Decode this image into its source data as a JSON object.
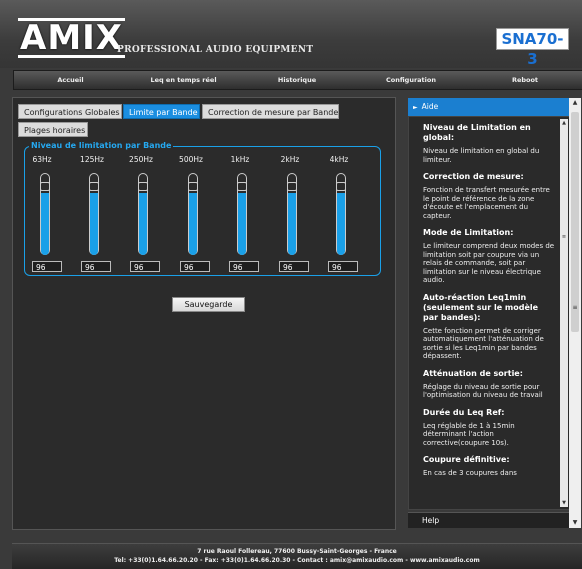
{
  "header": {
    "logo": "AMIX",
    "tagline": "PROFESSIONAL AUDIO EQUIPMENT",
    "model": "SNA70-3"
  },
  "nav": [
    {
      "label": "Accueil"
    },
    {
      "label": "Leq en temps réel"
    },
    {
      "label": "Historique"
    },
    {
      "label": "Configuration"
    },
    {
      "label": "Reboot"
    }
  ],
  "tabs": [
    {
      "label": "Configurations Globales",
      "active": false
    },
    {
      "label": "Limite par Bande",
      "active": true
    },
    {
      "label": "Correction de mesure par Bande",
      "active": false
    },
    {
      "label": "Plages horaires",
      "active": false
    }
  ],
  "bands": {
    "legend": "Niveau de limitation par Bande",
    "items": [
      {
        "freq": "63Hz",
        "value": "96",
        "level": 0.78
      },
      {
        "freq": "125Hz",
        "value": "96",
        "level": 0.78
      },
      {
        "freq": "250Hz",
        "value": "96",
        "level": 0.78
      },
      {
        "freq": "500Hz",
        "value": "96",
        "level": 0.78
      },
      {
        "freq": "1kHz",
        "value": "96",
        "level": 0.78
      },
      {
        "freq": "2kHz",
        "value": "96",
        "level": 0.78
      },
      {
        "freq": "4kHz",
        "value": "96",
        "level": 0.78
      }
    ],
    "accent_color": "#1aa0e8"
  },
  "save_label": "Sauvegarde",
  "help": {
    "header": "Aide",
    "footer": "Help",
    "sections": [
      {
        "title": "Niveau de Limitation en global:",
        "text": "Niveau de limitation en global du limiteur."
      },
      {
        "title": "Correction de mesure:",
        "text": "Fonction de transfert mesurée entre le point de référence de la zone d'écoute et l'emplacement du capteur."
      },
      {
        "title": "Mode de Limitation:",
        "text": "Le limiteur comprend deux modes de limitation soit par coupure via un relais de commande, soit par limitation sur le niveau électrique audio."
      },
      {
        "title": "Auto-réaction Leq1min (seulement sur le modèle par bandes):",
        "text": "Cette fonction permet de corriger automatiquement l'atténuation de sortie si les Leq1min par bandes dépassent."
      },
      {
        "title": "Atténuation de sortie:",
        "text": "Réglage du niveau de sortie pour l'optimisation du niveau de travail"
      },
      {
        "title": "Durée du Leq Ref:",
        "text": "Leq réglable de 1 à 15min déterminant l'action corrective(coupure 10s)."
      },
      {
        "title": "Coupure définitive:",
        "text": "En cas de 3 coupures dans"
      }
    ]
  },
  "footer": {
    "line1": "7 rue Raoul Follereau, 77600 Bussy-Saint-Georges - France",
    "line2": "Tel: +33(0)1.64.66.20.20 - Fax: +33(0)1.64.66.20.30 - Contact : amix@amixaudio.com - www.amixaudio.com"
  }
}
